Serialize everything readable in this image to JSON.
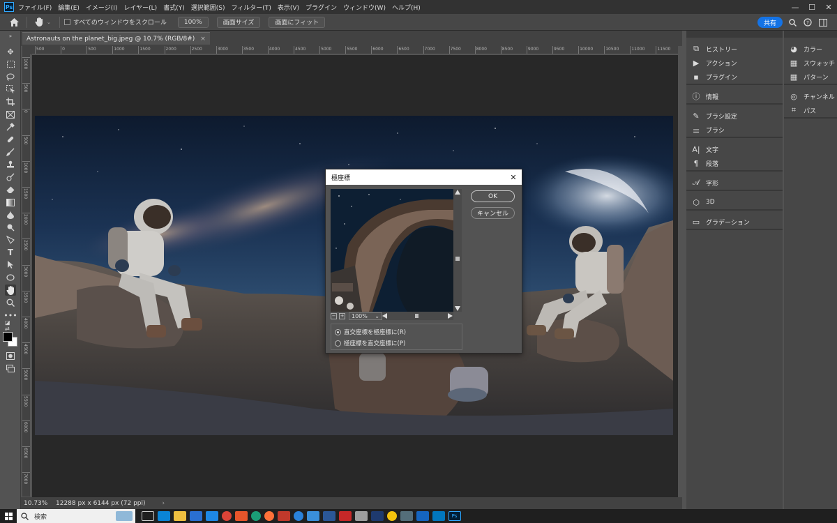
{
  "app": {
    "logo": "Ps"
  },
  "menu": [
    "ファイル(F)",
    "編集(E)",
    "イメージ(I)",
    "レイヤー(L)",
    "書式(Y)",
    "選択範囲(S)",
    "フィルター(T)",
    "表示(V)",
    "プラグイン",
    "ウィンドウ(W)",
    "ヘルプ(H)"
  ],
  "window_controls": {
    "minimize": "—",
    "maximize": "☐",
    "close": "✕"
  },
  "options_bar": {
    "scroll_all_label": "すべてのウィンドウをスクロール",
    "zoom_100": "100%",
    "screen_size": "画面サイズ",
    "fit_screen": "画面にフィット",
    "share": "共有"
  },
  "document": {
    "tab_title": "Astronauts on the planet_big.jpeg @ 10.7% (RGB/8#)",
    "close": "×",
    "zoom": "10.73%",
    "info": "12288 px x 6144 px (72 ppi)",
    "status_arrow": "›"
  },
  "ruler_top_labels": [
    "500",
    "0",
    "500",
    "1000",
    "1500",
    "2000",
    "2500",
    "3000",
    "3500",
    "4000",
    "4500",
    "5000",
    "5500",
    "6000",
    "6500",
    "7000",
    "7500",
    "8000",
    "8500",
    "9000",
    "9500",
    "10000",
    "10500",
    "11000",
    "11500",
    "12000"
  ],
  "ruler_left_labels": [
    "1000",
    "500",
    "0",
    "500",
    "1000",
    "1500",
    "2000",
    "2500",
    "3000",
    "3500",
    "4000",
    "4500",
    "5000",
    "5500",
    "6000",
    "6500",
    "7000"
  ],
  "panels_left": [
    {
      "label": "ヒストリー",
      "icon": "history-icon",
      "glyph": "⧉"
    },
    {
      "label": "アクション",
      "icon": "actions-icon",
      "glyph": "▶"
    },
    {
      "label": "プラグイン",
      "icon": "plugins-icon",
      "glyph": "▪"
    },
    {
      "label": "情報",
      "icon": "info-icon",
      "glyph": "ⓘ"
    },
    {
      "label": "ブラシ設定",
      "icon": "brush-settings-icon",
      "glyph": "✎"
    },
    {
      "label": "ブラシ",
      "icon": "brushes-icon",
      "glyph": "⚌"
    },
    {
      "label": "文字",
      "icon": "character-icon",
      "glyph": "A|"
    },
    {
      "label": "段落",
      "icon": "paragraph-icon",
      "glyph": "¶"
    },
    {
      "label": "字形",
      "icon": "glyphs-icon",
      "glyph": "𝒜"
    },
    {
      "label": "3D",
      "icon": "3d-icon",
      "glyph": "⬡"
    },
    {
      "label": "グラデーション",
      "icon": "gradients-icon",
      "glyph": "▭"
    }
  ],
  "panels_right": [
    {
      "label": "カラー",
      "icon": "color-icon",
      "glyph": "◕"
    },
    {
      "label": "スウォッチ",
      "icon": "swatches-icon",
      "glyph": "▦"
    },
    {
      "label": "パターン",
      "icon": "patterns-icon",
      "glyph": "▦"
    },
    {
      "label": "チャンネル",
      "icon": "channels-icon",
      "glyph": "◎"
    },
    {
      "label": "パス",
      "icon": "paths-icon",
      "glyph": "⌗"
    }
  ],
  "dialog": {
    "title": "極座標",
    "close": "✕",
    "ok": "OK",
    "cancel": "キャンセル",
    "zoom": "100%",
    "zoom_minus": "−",
    "zoom_plus": "+",
    "zoom_dropdown": "⌄",
    "option_rect_to_polar": "直交座標を極座標に(R)",
    "option_polar_to_rect": "極座標を直交座標に(P)",
    "selected_option": "rect_to_polar"
  },
  "taskbar": {
    "search_placeholder": "検索",
    "start_icon": "windows-start-icon"
  }
}
